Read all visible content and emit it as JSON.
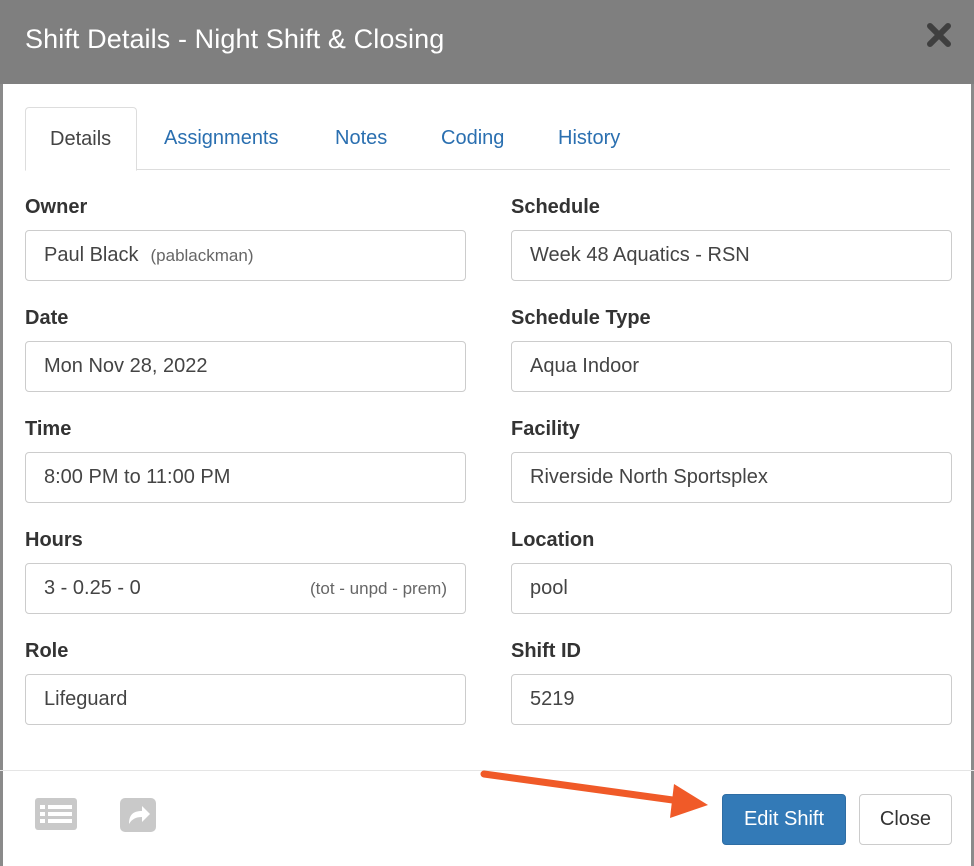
{
  "modal": {
    "title": "Shift Details - Night Shift & Closing"
  },
  "tabs": [
    {
      "label": "Details",
      "active": true
    },
    {
      "label": "Assignments",
      "active": false
    },
    {
      "label": "Notes",
      "active": false
    },
    {
      "label": "Coding",
      "active": false
    },
    {
      "label": "History",
      "active": false
    }
  ],
  "fields": {
    "owner": {
      "label": "Owner",
      "value": "Paul Black",
      "sub": "(pablackman)"
    },
    "schedule": {
      "label": "Schedule",
      "value": "Week 48 Aquatics - RSN"
    },
    "date": {
      "label": "Date",
      "value": "Mon Nov 28, 2022"
    },
    "schedule_type": {
      "label": "Schedule Type",
      "value": "Aqua Indoor"
    },
    "time": {
      "label": "Time",
      "value": "8:00 PM to 11:00 PM"
    },
    "facility": {
      "label": "Facility",
      "value": "Riverside North Sportsplex"
    },
    "hours": {
      "label": "Hours",
      "value": "3 - 0.25 - 0",
      "hint": "(tot - unpd - prem)"
    },
    "location": {
      "label": "Location",
      "value": "pool"
    },
    "role": {
      "label": "Role",
      "value": "Lifeguard"
    },
    "shift_id": {
      "label": "Shift ID",
      "value": "5219"
    }
  },
  "footer": {
    "icons": [
      "list-icon",
      "share-icon"
    ],
    "edit_label": "Edit Shift",
    "close_label": "Close"
  },
  "colors": {
    "header_bg": "#7f7f7f",
    "link": "#2a6fb0",
    "primary": "#337ab7",
    "annotation_arrow": "#f05a28"
  }
}
